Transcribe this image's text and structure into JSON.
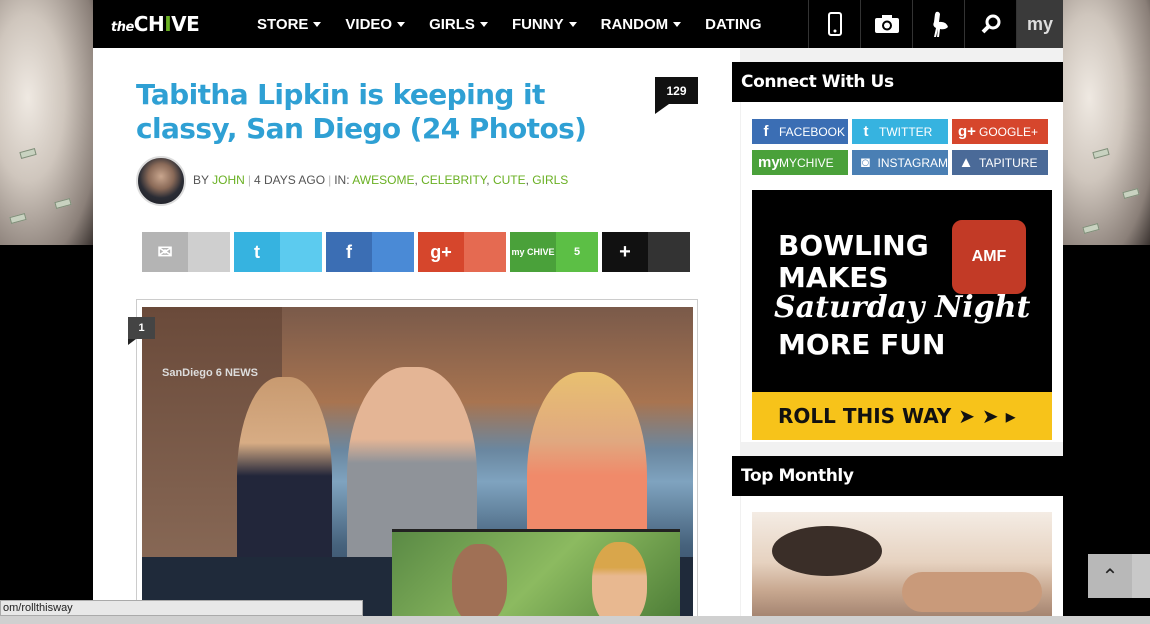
{
  "nav": {
    "logo_the": "the",
    "logo_chive": "CH",
    "logo_i": "I",
    "logo_ve": "VE",
    "items": [
      {
        "label": "STORE"
      },
      {
        "label": "VIDEO"
      },
      {
        "label": "GIRLS"
      },
      {
        "label": "FUNNY"
      },
      {
        "label": "RANDOM"
      },
      {
        "label": "DATING"
      }
    ],
    "icons": [
      "phone-icon",
      "camera-icon",
      "ostrich-icon",
      "search-icon"
    ],
    "my_label": "my"
  },
  "article": {
    "title": "Tabitha Lipkin is keeping it classy, San Diego (24 Photos)",
    "comment_count": "129",
    "byline": {
      "by": "BY",
      "author": "JOHN",
      "time": "4 DAYS AGO",
      "in": "IN:",
      "categories": [
        "AWESOME",
        "CELEBRITY",
        "CUTE",
        "GIRLS"
      ]
    },
    "share": {
      "email_icon": "✉",
      "twitter_icon": "t",
      "facebook_icon": "f",
      "googleplus_icon": "g+",
      "mychive_icon": "my CHIVE",
      "mychive_count": "5",
      "more_icon": "+"
    },
    "photo_number": "1",
    "photo_station_logo": "SanDiego 6 NEWS"
  },
  "sidebar": {
    "connect_title": "Connect With Us",
    "social": [
      {
        "icon": "f",
        "label": "FACEBOOK"
      },
      {
        "icon": "t",
        "label": "TWITTER"
      },
      {
        "icon": "g+",
        "label": "GOOGLE+"
      },
      {
        "icon": "my",
        "label": "MYCHIVE"
      },
      {
        "icon": "◙",
        "label": "INSTAGRAM"
      },
      {
        "icon": "▲",
        "label": "TAPITURE"
      }
    ],
    "ad": {
      "line1": "BOWLING",
      "line2": "MAKES",
      "line3": "Saturday Night",
      "line4": "MORE FUN",
      "brand": "AMF",
      "cta": "ROLL THIS WAY ➤ ➤ ▸"
    },
    "top_monthly_title": "Top Monthly"
  },
  "scroll_top_icon": "⌃",
  "status_url": "om/rollthisway",
  "colors": {
    "accent_blue": "#2fa0d4",
    "accent_green": "#6ab023",
    "ad_yellow": "#f7c31a"
  }
}
